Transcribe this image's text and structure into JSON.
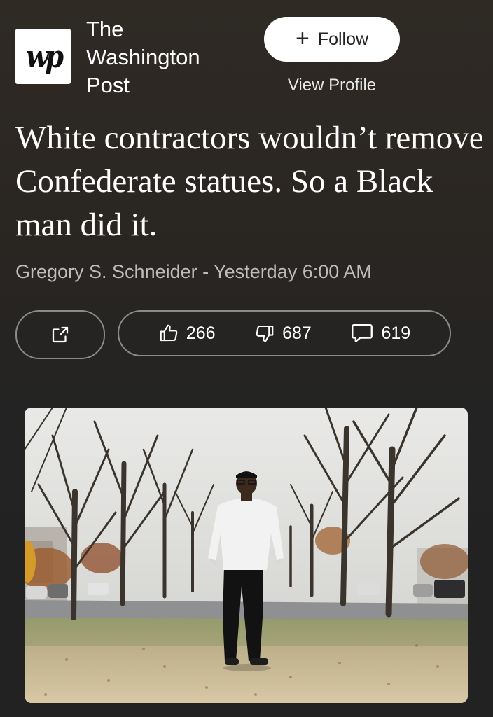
{
  "publisher": {
    "logo_text": "wp",
    "name_lines": [
      "The",
      "Washington",
      "Post"
    ],
    "follow_label": "Follow",
    "view_profile_label": "View Profile"
  },
  "article": {
    "headline": "White contractors wouldn’t remove Confederate statues. So a Black man did it.",
    "byline": "Gregory S. Schneider - Yesterday 6:00 AM"
  },
  "actions": {
    "likes": "266",
    "dislikes": "687",
    "comments": "619"
  },
  "icons": {
    "share": "share-icon",
    "like": "thumbs-up-icon",
    "dislike": "thumbs-down-icon",
    "comment": "comment-icon",
    "follow": "plus-icon"
  }
}
